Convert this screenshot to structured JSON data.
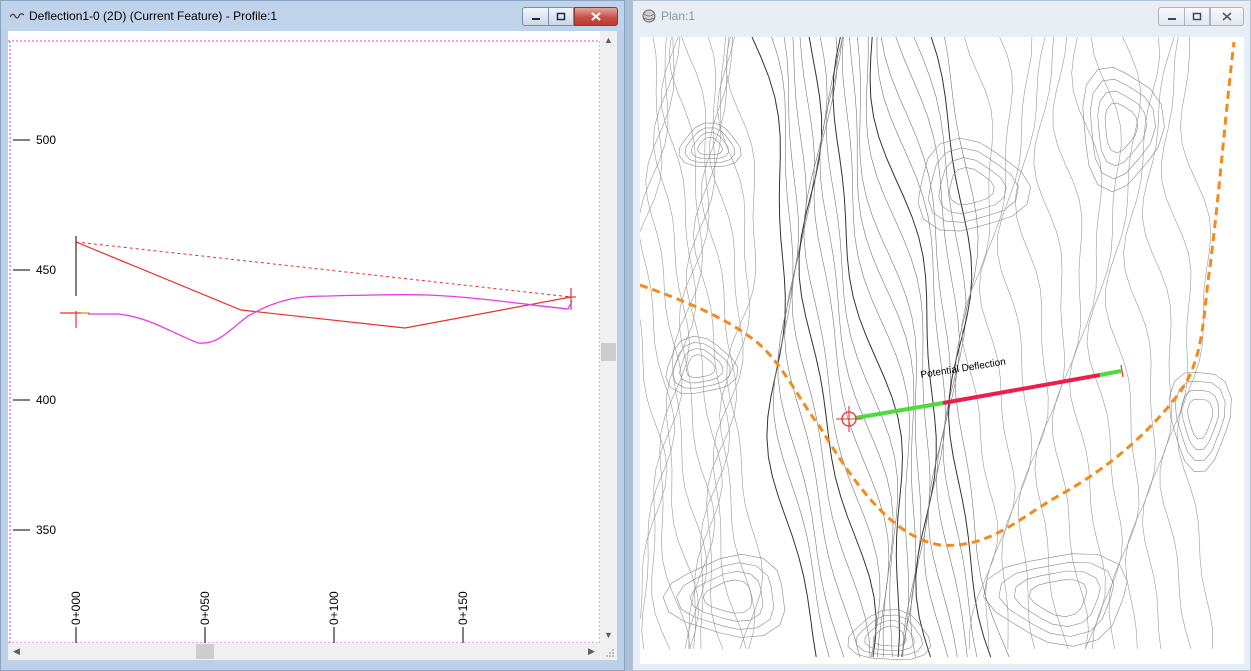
{
  "profile_window": {
    "title": "Deflection1-0 (2D) (Current Feature) - Profile:1",
    "title_icon": "profile-wave-icon",
    "y_tick_labels": [
      "500",
      "450",
      "400",
      "350"
    ],
    "x_tick_labels": [
      "0+000",
      "0+050",
      "0+100",
      "0+150"
    ],
    "caption_buttons": [
      "minimize-icon",
      "maximize-icon",
      "close-icon"
    ]
  },
  "plan_window": {
    "title": "Plan:1",
    "title_icon": "globe-icon",
    "annotation": "Potential Deflection",
    "caption_buttons": [
      "minimize-icon",
      "maximize-icon",
      "close-icon"
    ]
  },
  "colors": {
    "ground_profile": "#e8312a",
    "design_profile": "#e23ce8",
    "alignment_path": "#f28a1c",
    "safe_segment": "#4cdc3c",
    "deflection_segment": "#ee1e4a",
    "contour": "#555555"
  }
}
